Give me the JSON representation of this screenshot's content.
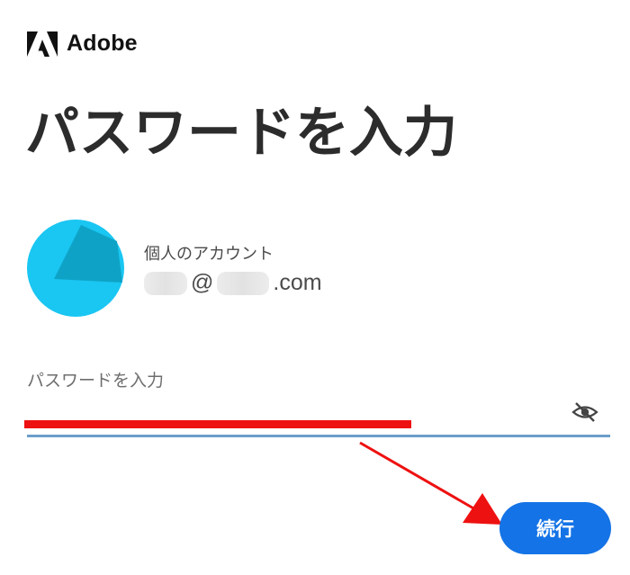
{
  "brand": {
    "name": "Adobe",
    "logo_icon": "adobe-logo-icon",
    "color": "#111111"
  },
  "page_title": "パスワードを入力",
  "account": {
    "avatar_icon": "avatar-icon",
    "avatar_colors": [
      "#1ac6f2",
      "#0ea3c6"
    ],
    "type_label": "個人のアカウント",
    "email_at": "@",
    "email_suffix": ".com"
  },
  "password": {
    "label": "パスワードを入力",
    "value": "",
    "toggle_icon": "eye-slash-icon",
    "underline_color": "#6b9ec9"
  },
  "annotation": {
    "redaction_color": "#ee1111",
    "arrow_color": "#ee1111"
  },
  "continue_button": {
    "label": "続行",
    "color": "#1473e6"
  }
}
